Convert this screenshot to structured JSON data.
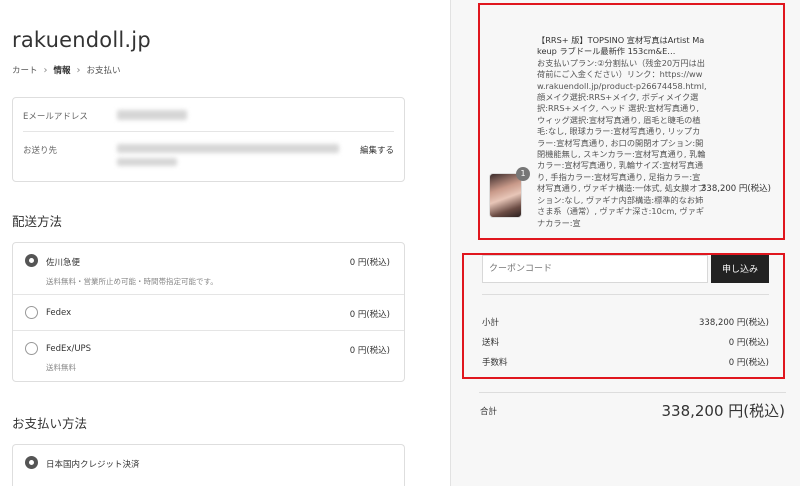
{
  "shop": {
    "title": "rakuendoll.jp"
  },
  "breadcrumb": {
    "cart": "カート",
    "info": "情報",
    "payment": "お支払い"
  },
  "contact": {
    "email_label": "Eメールアドレス",
    "ship_label": "お送り先",
    "edit": "編集する"
  },
  "shipping": {
    "title": "配送方法",
    "options": [
      {
        "label": "佐川急便",
        "sub": "送料無料・営業所止め可能・時間帯指定可能です。",
        "price": "0 円(税込)",
        "selected": true
      },
      {
        "label": "Fedex",
        "sub": "",
        "price": "0 円(税込)",
        "selected": false
      },
      {
        "label": "FedEx/UPS",
        "sub": "送料無料",
        "price": "0 円(税込)",
        "selected": false
      }
    ]
  },
  "payment": {
    "title": "お支払い方法",
    "options": [
      {
        "label": "日本国内クレジット決済",
        "selected": true
      }
    ]
  },
  "product": {
    "quantity": "1",
    "name": "【RRS+ 版】TOPSINO 宣材写真はArtist Makeup ラブドール最新作 153cm&E…",
    "details": "お支払いプラン:②分割払い（残金20万円は出荷前にご入金ください）リンク：https://www.rakuendoll.jp/product-p26674458.html, 顔メイク選択:RRS+メイク, ボディメイク選択:RRS+メイク, ヘッド 選択:宣材写真通り, ウィッグ選択:宣材写真通り, 眉毛と睫毛の植毛:なし, 眼球カラー:宣材写真通り, リップカラー:宣材写真通り, お口の開閉オプション:開閉機能無し, スキンカラー:宣材写真通り, 乳輪カラー:宣材写真通り, 乳輪サイズ:宣材写真通り, 手指カラー:宣材写真通り, 足指カラー:宣材写真通り, ヴァギナ構造:一体式, 処女膜オプション:なし, ヴァギナ内部構造:標準的なお姉さま系（通常）, ヴァギナ深さ:10cm, ヴァギナカラー:宣",
    "price": "338,200 円(税込)"
  },
  "coupon": {
    "placeholder": "クーポンコード",
    "apply": "申し込み"
  },
  "summary": {
    "rows": [
      {
        "label": "小計",
        "value": "338,200 円(税込)"
      },
      {
        "label": "送料",
        "value": "0 円(税込)"
      },
      {
        "label": "手数料",
        "value": "0 円(税込)"
      }
    ],
    "total_label": "合計",
    "total_value": "338,200 円(税込)"
  },
  "colors": {
    "highlight": "#e0161e",
    "button": "#222222",
    "sidebar_bg": "#f7f7f7"
  }
}
